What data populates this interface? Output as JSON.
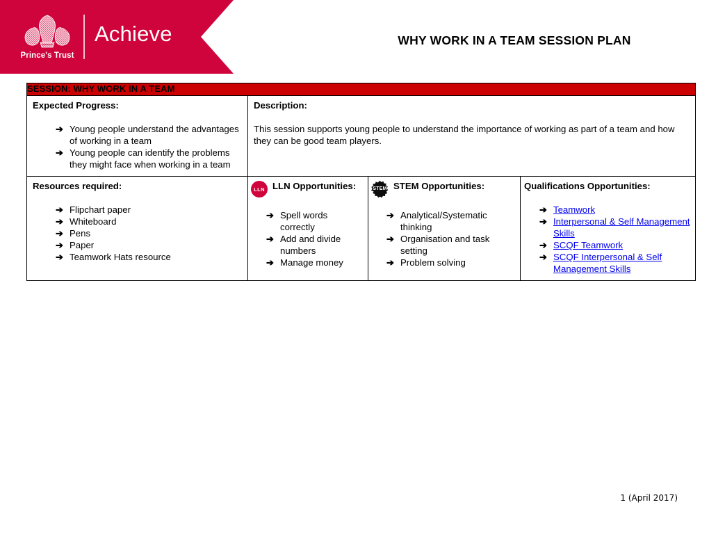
{
  "banner": {
    "brand_name": "Achieve",
    "crest_word": "Prince's Trust",
    "crest_icon": "princes-trust-feathers-crest",
    "banner_color": "#D0043C"
  },
  "header": {
    "title": "WHY WORK IN A TEAM SESSION PLAN"
  },
  "table": {
    "session_header": "SESSION: WHY WORK IN A TEAM",
    "session_header_color": "#CC0000",
    "bullet_glyph": "➔",
    "expected_progress": {
      "title": "Expected Progress:",
      "items": [
        "Young people understand the advantages of working in a team",
        "Young people can identify the problems they might face when working in a team"
      ]
    },
    "description": {
      "title": "Description:",
      "text": "This session supports young people to understand the importance of working as part of a team and how they can be good team players."
    },
    "resources": {
      "title": "Resources required:",
      "items": [
        "Flipchart paper",
        "Whiteboard",
        "Pens",
        "Paper",
        "Teamwork Hats resource"
      ]
    },
    "lln": {
      "icon": "lln-badge-icon",
      "icon_label": "LLN",
      "title": "LLN Opportunities:",
      "items": [
        "Spell words correctly",
        "Add and divide numbers",
        "Manage money"
      ]
    },
    "stem": {
      "icon": "stem-badge-icon",
      "icon_label": "STEM",
      "title": "STEM Opportunities:",
      "items": [
        "Analytical/Systematic thinking",
        "Organisation and task setting",
        "Problem solving"
      ]
    },
    "qualifications": {
      "title": "Qualifications Opportunities:",
      "link_color": "#0000EE",
      "items": [
        "Teamwork",
        "Interpersonal & Self Management Skills",
        "SCQF Teamwork",
        "SCQF Interpersonal & Self Management Skills"
      ]
    }
  },
  "footer": {
    "page_note": "1 (April 2017)"
  }
}
